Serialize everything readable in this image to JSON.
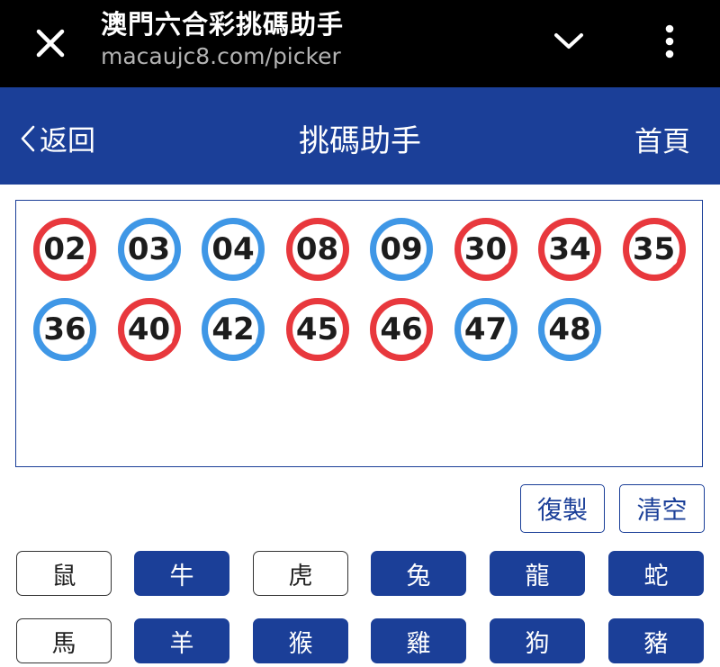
{
  "browser": {
    "page_title": "澳門六合彩挑碼助手",
    "url": "macaujc8.com/picker"
  },
  "header": {
    "back_label": "返回",
    "title": "挑碼助手",
    "home_label": "首頁"
  },
  "colors": {
    "brand_blue": "#1b3f98",
    "ball_red": "#e8383d",
    "ball_blue": "#3f97e6"
  },
  "balls": [
    {
      "number": "02",
      "color": "red"
    },
    {
      "number": "03",
      "color": "blue"
    },
    {
      "number": "04",
      "color": "blue"
    },
    {
      "number": "08",
      "color": "red"
    },
    {
      "number": "09",
      "color": "blue"
    },
    {
      "number": "30",
      "color": "red"
    },
    {
      "number": "34",
      "color": "red"
    },
    {
      "number": "35",
      "color": "red"
    },
    {
      "number": "36",
      "color": "blue"
    },
    {
      "number": "40",
      "color": "red"
    },
    {
      "number": "42",
      "color": "blue"
    },
    {
      "number": "45",
      "color": "red"
    },
    {
      "number": "46",
      "color": "red"
    },
    {
      "number": "47",
      "color": "blue"
    },
    {
      "number": "48",
      "color": "blue"
    }
  ],
  "actions": {
    "copy_label": "復製",
    "clear_label": "清空"
  },
  "zodiacs": [
    {
      "label": "鼠",
      "selected": false
    },
    {
      "label": "牛",
      "selected": true
    },
    {
      "label": "虎",
      "selected": false
    },
    {
      "label": "兔",
      "selected": true
    },
    {
      "label": "龍",
      "selected": true
    },
    {
      "label": "蛇",
      "selected": true
    },
    {
      "label": "馬",
      "selected": false
    },
    {
      "label": "羊",
      "selected": true
    },
    {
      "label": "猴",
      "selected": true
    },
    {
      "label": "雞",
      "selected": true
    },
    {
      "label": "狗",
      "selected": true
    },
    {
      "label": "豬",
      "selected": true
    }
  ]
}
